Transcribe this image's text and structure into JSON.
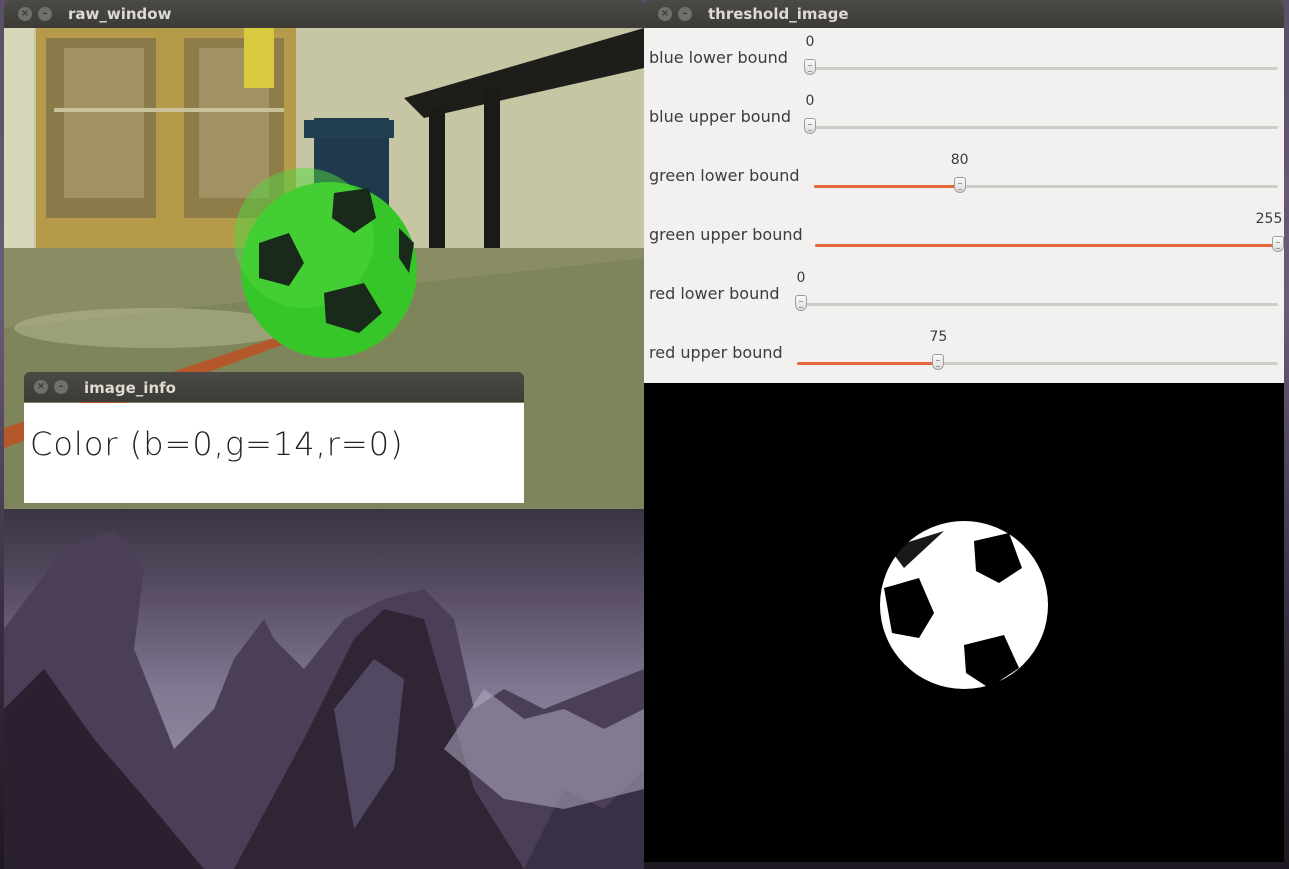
{
  "raw_window": {
    "title": "raw_window"
  },
  "image_info": {
    "title": "image_info",
    "text": "Color (b=0,g=14,r=0)"
  },
  "threshold_image": {
    "title": "threshold_image",
    "trackbars": [
      {
        "label": "blue lower bound",
        "value": "0",
        "fraction": 0.0
      },
      {
        "label": "blue upper bound",
        "value": "0",
        "fraction": 0.0
      },
      {
        "label": "green lower bound",
        "value": "80",
        "fraction": 0.314
      },
      {
        "label": "green upper bound",
        "value": "255",
        "fraction": 1.0
      },
      {
        "label": "red lower bound",
        "value": "0",
        "fraction": 0.0
      },
      {
        "label": "red upper bound",
        "value": "75",
        "fraction": 0.294
      }
    ]
  },
  "colors": {
    "titlebar": "#3c3b37",
    "accent": "#e3683a",
    "panel": "#f2f1f0",
    "ball_green": "#37c62a"
  },
  "icons": {
    "close": "close-icon",
    "minimize": "minimize-icon"
  }
}
